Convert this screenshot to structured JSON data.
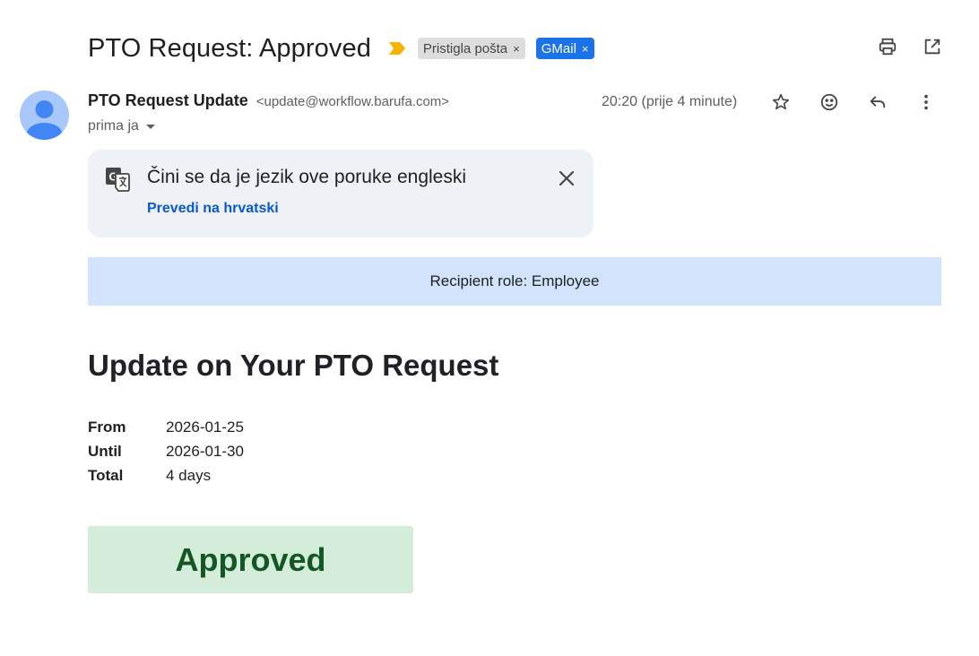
{
  "subject": {
    "title": "PTO Request: Approved",
    "labels": [
      {
        "text": "Pristigla pošta",
        "close": "×"
      },
      {
        "text": "GMail",
        "close": "×"
      }
    ]
  },
  "toolbar": {
    "print_icon": "printer-icon",
    "popout_icon": "open-in-new-window-icon"
  },
  "sender": {
    "name": "PTO Request Update",
    "email": "<update@workflow.barufa.com>",
    "to": "prima ja",
    "time": "20:20 (prije 4 minute)"
  },
  "translate": {
    "message": "Čini se da je jezik ove poruke engleski",
    "link": "Prevedi na hrvatski"
  },
  "email": {
    "role_bar": "Recipient role: Employee",
    "title": "Update on Your PTO Request",
    "details": [
      {
        "label": "From",
        "value": "2026-01-25"
      },
      {
        "label": "Until",
        "value": "2026-01-30"
      },
      {
        "label": "Total",
        "value": "4 days"
      }
    ],
    "status": "Approved"
  },
  "colors": {
    "accent": "#1a73e8",
    "link": "#0b57d0",
    "role_bar_bg": "#d2e3fc",
    "status_bg": "#d4edda",
    "status_text": "#155724",
    "importance": "#f4b400"
  }
}
